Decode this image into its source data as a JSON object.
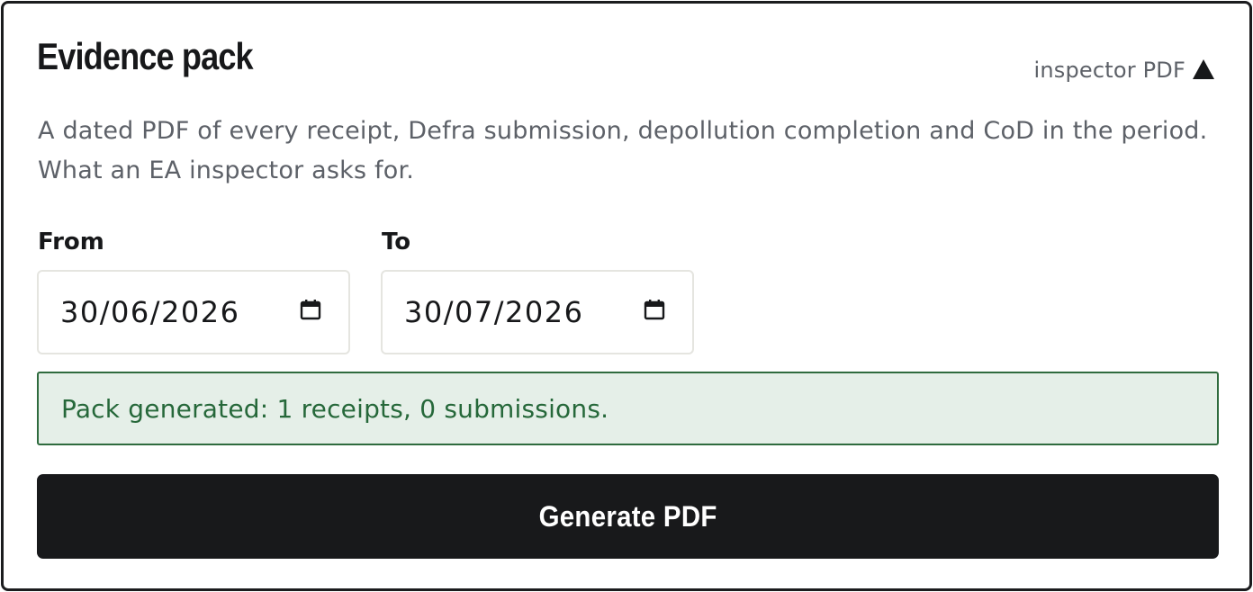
{
  "panel": {
    "title": "Evidence pack",
    "badge_label": "inspector PDF",
    "badge_icon": "warning-triangle-icon",
    "description": "A dated PDF of every receipt, Defra submission, depollution completion and CoD in the period. What an EA inspector asks for."
  },
  "form": {
    "from_label": "From",
    "from_value": "30/06/2026",
    "to_label": "To",
    "to_value": "30/07/2026",
    "date_icon": "calendar-icon"
  },
  "status": {
    "message": "Pack generated: 1 receipts, 0 submissions."
  },
  "actions": {
    "generate_label": "Generate PDF"
  },
  "colors": {
    "success_text": "#26683a",
    "success_bg": "#e5efe8",
    "button_bg": "#18191b"
  }
}
